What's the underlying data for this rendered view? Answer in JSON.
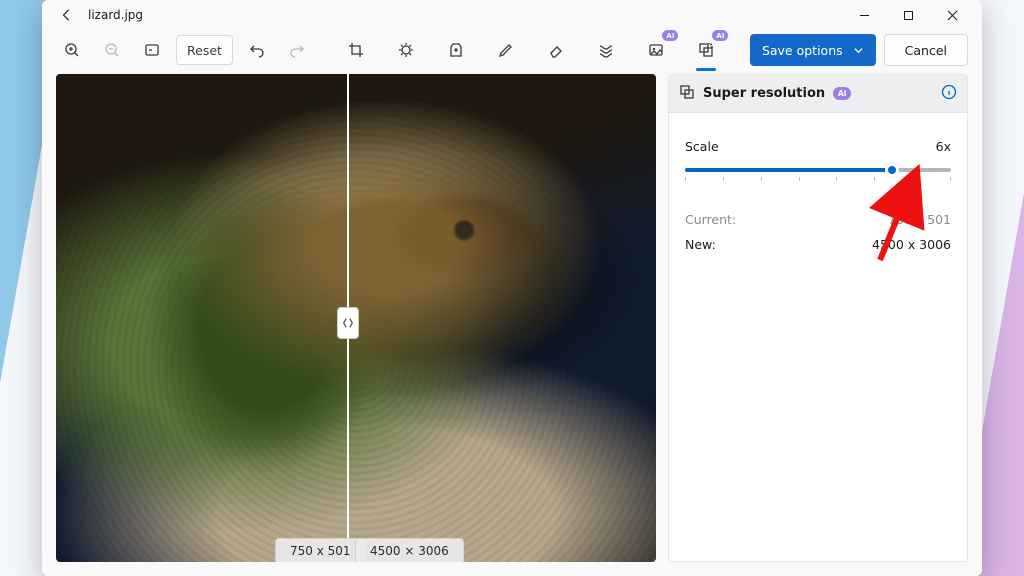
{
  "titlebar": {
    "filename": "lizard.jpg"
  },
  "toolbar": {
    "reset_label": "Reset",
    "save_label": "Save options",
    "cancel_label": "Cancel",
    "ai_badge": "AI"
  },
  "canvas": {
    "left_dim_label": "750 x 501",
    "right_dim_label": "4500 × 3006"
  },
  "panel": {
    "title": "Super resolution",
    "ai_badge": "AI",
    "scale_label": "Scale",
    "scale_value": "6x",
    "scale_fraction": 0.78,
    "current_label": "Current:",
    "current_value": "750 x 501",
    "new_label": "New:",
    "new_value": "4500 x 3006"
  }
}
